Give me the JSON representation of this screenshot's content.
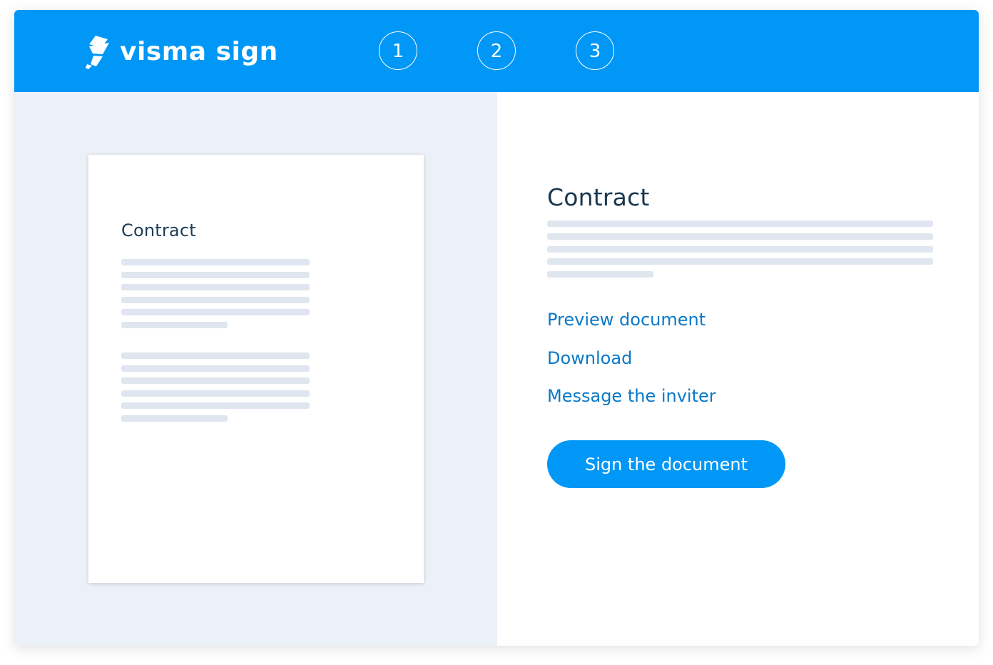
{
  "header": {
    "brand_name": "visma sign",
    "brand_icon": "visma-sign-logo-icon",
    "background_color": "#0197f6",
    "steps": [
      "1",
      "2",
      "3"
    ]
  },
  "document_preview": {
    "title": "Contract"
  },
  "details": {
    "title": "Contract",
    "links": {
      "preview": "Preview document",
      "download": "Download",
      "message": "Message the inviter"
    },
    "sign_button_label": "Sign the document"
  },
  "colors": {
    "accent": "#0197f6",
    "link": "#0a78c7",
    "heading": "#18364f",
    "left_pane_bg": "#ecf1f8",
    "placeholder_line": "#dfe6ef"
  }
}
